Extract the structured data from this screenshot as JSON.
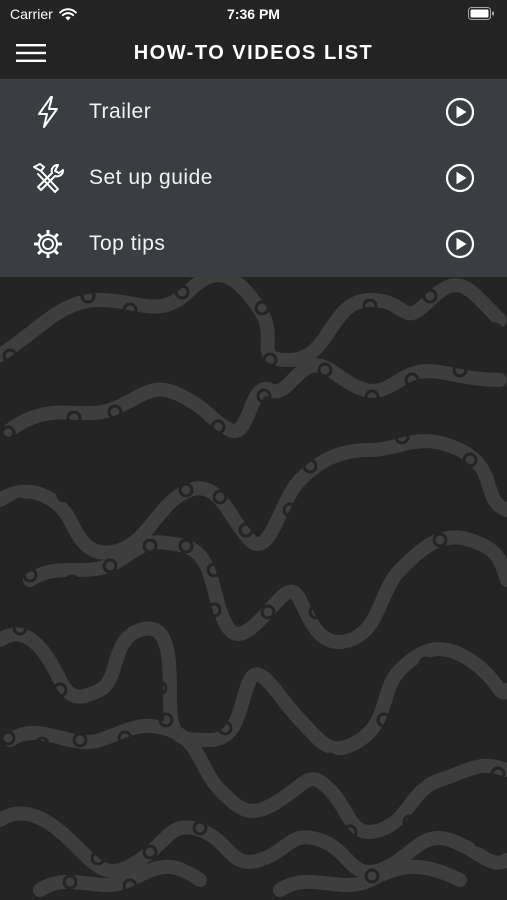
{
  "status_bar": {
    "carrier": "Carrier",
    "time": "7:36 PM",
    "wifi_icon": "wifi-icon",
    "battery_icon": "battery-icon"
  },
  "nav": {
    "title": "HOW-TO VIDEOS LIST",
    "menu_icon": "hamburger-menu-icon"
  },
  "items": [
    {
      "label": "Trailer",
      "icon": "lightning-bolt-icon",
      "action_icon": "play-circle-icon"
    },
    {
      "label": "Set up guide",
      "icon": "wrench-hammer-icon",
      "action_icon": "play-circle-icon"
    },
    {
      "label": "Top tips",
      "icon": "gear-icon",
      "action_icon": "play-circle-icon"
    }
  ],
  "colors": {
    "background": "#242424",
    "nav_background": "#232323",
    "list_background": "#3a3d42",
    "chain_pattern": "#3e3e3e",
    "text": "#ffffff"
  }
}
